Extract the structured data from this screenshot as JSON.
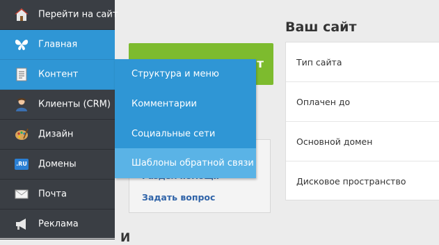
{
  "sidebar": {
    "items": [
      {
        "label": "Перейти на сайт",
        "icon": "home-icon"
      },
      {
        "label": "Главная",
        "icon": "butterfly-icon"
      },
      {
        "label": "Контент",
        "icon": "document-icon"
      },
      {
        "label": "Клиенты (CRM)",
        "icon": "person-icon"
      },
      {
        "label": "Дизайн",
        "icon": "palette-icon"
      },
      {
        "label": "Домены",
        "icon": "ru-domain-icon",
        "icon_text": ".RU"
      },
      {
        "label": "Почта",
        "icon": "mail-icon"
      },
      {
        "label": "Реклама",
        "icon": "megaphone-icon"
      }
    ],
    "active_index": 1,
    "hover_index": 2
  },
  "dropdown": {
    "items": [
      {
        "label": "Структура и меню"
      },
      {
        "label": "Комментарии"
      },
      {
        "label": "Социальные сети"
      },
      {
        "label": "Шаблоны обратной связи"
      }
    ],
    "hover_index": 3
  },
  "main": {
    "green_button_partial": "т",
    "help_links": {
      "link_partial": "Раздел помощи",
      "ask": "Задать вопрос"
    },
    "partial_heading": "И"
  },
  "site_panel": {
    "title": "Ваш сайт",
    "rows": [
      {
        "label": "Тип сайта"
      },
      {
        "label": "Оплачен до"
      },
      {
        "label": "Основной домен"
      },
      {
        "label": "Дисковое пространство"
      }
    ]
  },
  "colors": {
    "sidebar_bg": "#3a3e44",
    "accent_blue": "#2f96d5",
    "dropdown_hover": "#5ab3e6",
    "green_button": "#7dbb2e"
  }
}
